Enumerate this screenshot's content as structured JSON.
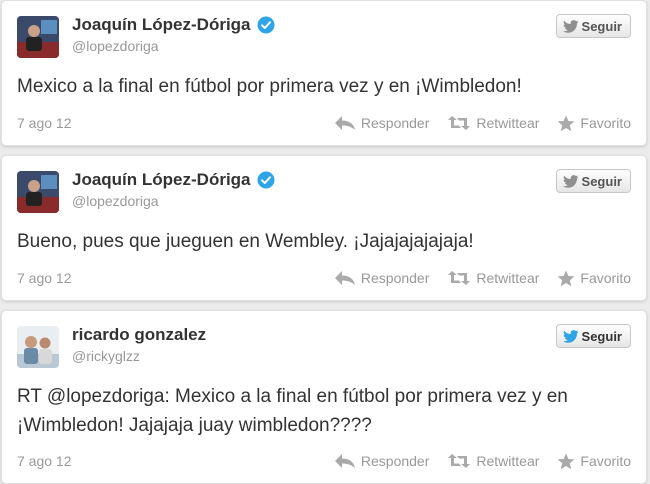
{
  "colors": {
    "text": "#333333",
    "muted": "#999999",
    "verified": "#2fa4e7",
    "twitter_blue": "#2fa4e7"
  },
  "icons": {
    "follow": "bird-icon",
    "verified": "verified-badge-icon",
    "reply": "reply-arrow-icon",
    "retweet": "retweet-icon",
    "favorite": "star-icon"
  },
  "tweets": [
    {
      "name": "Joaquín López-Dóriga",
      "handle": "@lopezdoriga",
      "follow_label": "Seguir",
      "text": "Mexico a la final en fútbol por primera vez y en ¡Wimbledon!",
      "date": "7 ago 12",
      "reply_label": "Responder",
      "retweet_label": "Retwittear",
      "favorite_label": "Favorito"
    },
    {
      "name": "Joaquín López-Dóriga",
      "handle": "@lopezdoriga",
      "follow_label": "Seguir",
      "text": "Bueno, pues que jueguen en Wembley. ¡Jajajajajajaja!",
      "date": "7 ago 12",
      "reply_label": "Responder",
      "retweet_label": "Retwittear",
      "favorite_label": "Favorito"
    },
    {
      "name": "ricardo gonzalez",
      "handle": "@rickyglzz",
      "follow_label": "Seguir",
      "text": "RT @lopezdoriga: Mexico a la final en fútbol por primera vez y en ¡Wimbledon! Jajajaja juay wimbledon????",
      "date": "7 ago 12",
      "reply_label": "Responder",
      "retweet_label": "Retwittear",
      "favorite_label": "Favorito"
    }
  ]
}
